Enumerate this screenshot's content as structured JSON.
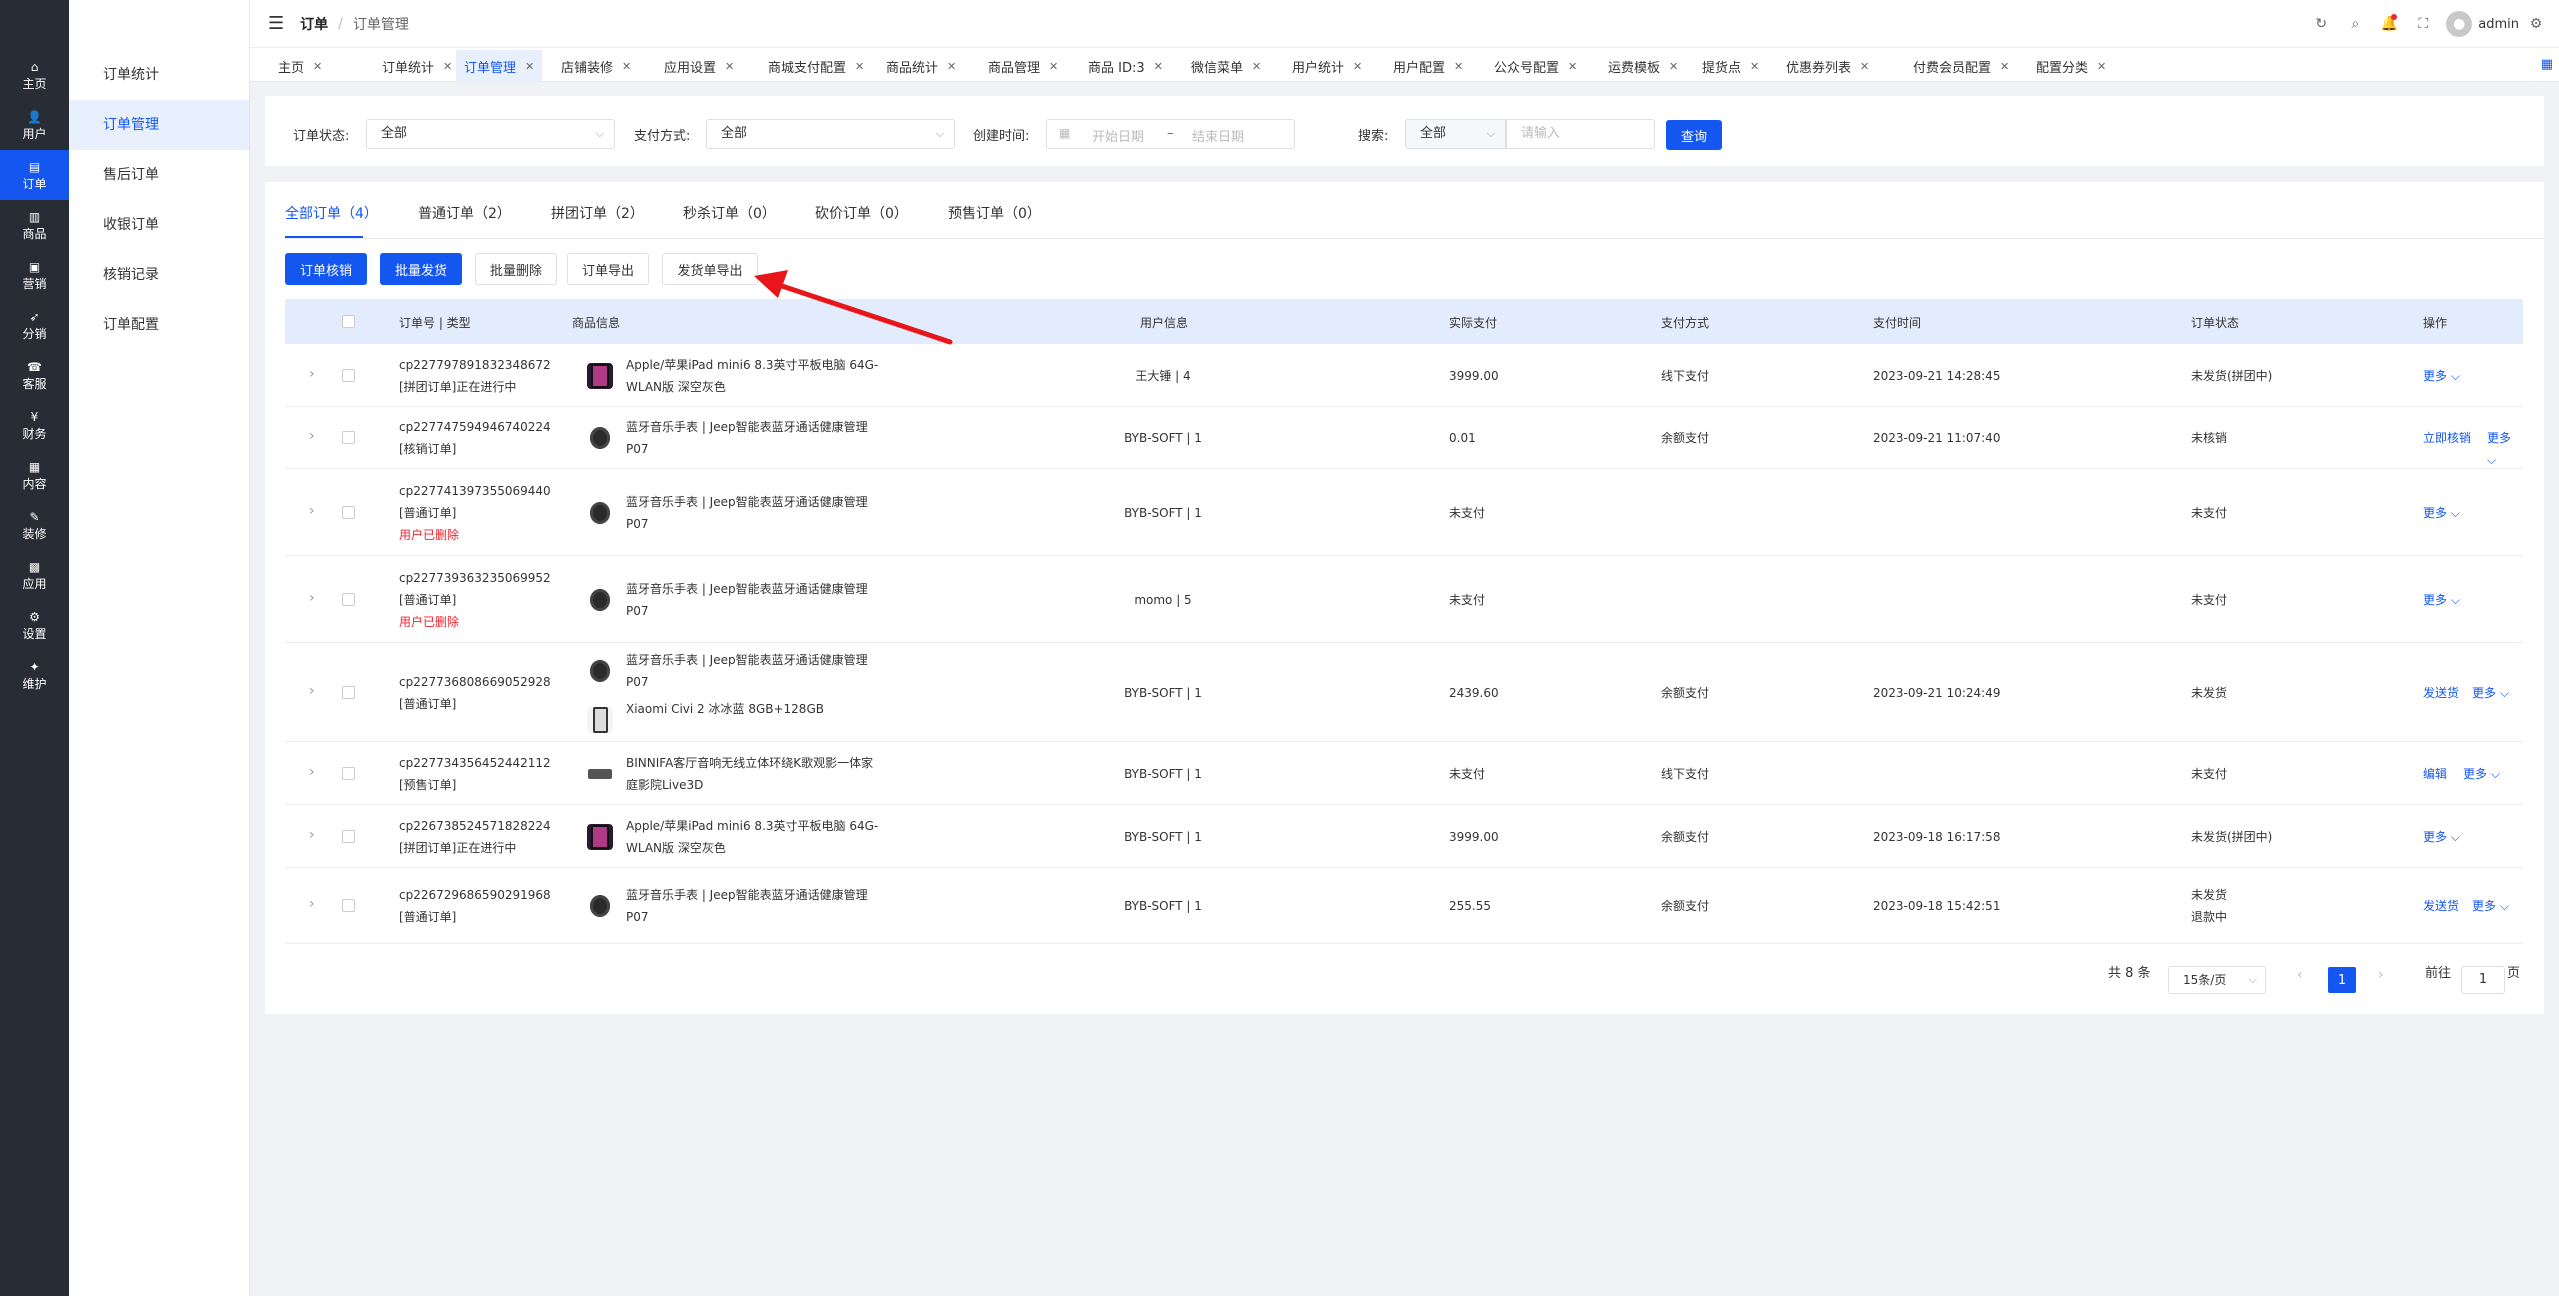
{
  "sidebar": {
    "items": [
      {
        "label": "主页",
        "icon": "⌂"
      },
      {
        "label": "用户",
        "icon": "👤"
      },
      {
        "label": "订单",
        "icon": "▤"
      },
      {
        "label": "商品",
        "icon": "▥"
      },
      {
        "label": "营销",
        "icon": "▣"
      },
      {
        "label": "分销",
        "icon": "➶"
      },
      {
        "label": "客服",
        "icon": "☎"
      },
      {
        "label": "财务",
        "icon": "¥"
      },
      {
        "label": "内容",
        "icon": "▦"
      },
      {
        "label": "装修",
        "icon": "✎"
      },
      {
        "label": "应用",
        "icon": "▩"
      },
      {
        "label": "设置",
        "icon": "⚙"
      },
      {
        "label": "维护",
        "icon": "✦"
      }
    ]
  },
  "subnav": {
    "items": [
      "订单统计",
      "订单管理",
      "售后订单",
      "收银订单",
      "核销记录",
      "订单配置"
    ]
  },
  "header": {
    "breadcrumb_root": "订单",
    "breadcrumb_sep": "/",
    "breadcrumb_current": "订单管理",
    "user": "admin"
  },
  "tabs": [
    "主页",
    "订单统计",
    "订单管理",
    "店铺装修",
    "应用设置",
    "商城支付配置",
    "商品统计",
    "商品管理",
    "商品 ID:3",
    "微信菜单",
    "用户统计",
    "用户配置",
    "公众号配置",
    "运费模板",
    "提货点",
    "优惠券列表",
    "付费会员配置",
    "配置分类"
  ],
  "filters": {
    "status_label": "订单状态:",
    "status_value": "全部",
    "pay_label": "支付方式:",
    "pay_value": "全部",
    "time_label": "创建时间:",
    "start_placeholder": "开始日期",
    "date_sep": "–",
    "end_placeholder": "结束日期",
    "search_label": "搜索:",
    "search_scope": "全部",
    "search_placeholder": "请输入",
    "query_button": "查询"
  },
  "order_tabs": [
    "全部订单（4）",
    "普通订单（2）",
    "拼团订单（2）",
    "秒杀订单（0）",
    "砍价订单（0）",
    "预售订单（0）"
  ],
  "actions": {
    "verify": "订单核销",
    "batch_ship": "批量发货",
    "batch_delete": "批量删除",
    "export_orders": "订单导出",
    "export_shipping": "发货单导出"
  },
  "table": {
    "headers": [
      "订单号 | 类型",
      "商品信息",
      "用户信息",
      "实际支付",
      "支付方式",
      "支付时间",
      "订单状态",
      "操作"
    ],
    "rows": [
      {
        "order_no": "cp227797891832348672",
        "type": "[拼团订单]正在进行中",
        "deleted": "",
        "products": [
          {
            "name1": "Apple/苹果iPad mini6 8.3英寸平板电脑 64G-",
            "name2": "WLAN版 深空灰色",
            "thumb": "ipad"
          }
        ],
        "user": "王大锤 | 4",
        "paid": "3999.00",
        "method": "线下支付",
        "time": "2023-09-21 14:28:45",
        "status": "未发货(拼团中)",
        "status2": "",
        "op1": "",
        "more": "更多 ⌵"
      },
      {
        "order_no": "cp227747594946740224",
        "type": "[核销订单]",
        "deleted": "",
        "products": [
          {
            "name1": "蓝牙音乐手表 | Jeep智能表蓝牙通话健康管理",
            "name2": "P07",
            "thumb": "watch"
          }
        ],
        "user": "BYB-SOFT | 1",
        "paid": "0.01",
        "method": "余额支付",
        "time": "2023-09-21 11:07:40",
        "status": "未核销",
        "status2": "",
        "op1": "立即核销",
        "more": "更多 ⌵"
      },
      {
        "order_no": "cp227741397355069440",
        "type": "[普通订单]",
        "deleted": "用户已删除",
        "products": [
          {
            "name1": "蓝牙音乐手表 | Jeep智能表蓝牙通话健康管理",
            "name2": "P07",
            "thumb": "watch"
          }
        ],
        "user": "BYB-SOFT | 1",
        "paid": "未支付",
        "method": "",
        "time": "",
        "status": "未支付",
        "status2": "",
        "op1": "",
        "more": "更多 ⌵"
      },
      {
        "order_no": "cp227739363235069952",
        "type": "[普通订单]",
        "deleted": "用户已删除",
        "products": [
          {
            "name1": "蓝牙音乐手表 | Jeep智能表蓝牙通话健康管理",
            "name2": "P07",
            "thumb": "watch"
          }
        ],
        "user": "momo | 5",
        "paid": "未支付",
        "method": "",
        "time": "",
        "status": "未支付",
        "status2": "",
        "op1": "",
        "more": "更多 ⌵"
      },
      {
        "order_no": "cp227736808669052928",
        "type": "[普通订单]",
        "deleted": "",
        "products": [
          {
            "name1": "蓝牙音乐手表 | Jeep智能表蓝牙通话健康管理",
            "name2": "P07",
            "thumb": "watch"
          },
          {
            "name1": "Xiaomi Civi 2 冰冰蓝 8GB+128GB",
            "name2": "",
            "thumb": "phone"
          }
        ],
        "user": "BYB-SOFT | 1",
        "paid": "2439.60",
        "method": "余额支付",
        "time": "2023-09-21 10:24:49",
        "status": "未发货",
        "status2": "",
        "op1": "发送货",
        "more": "更多 ⌵"
      },
      {
        "order_no": "cp227734356452442112",
        "type": "[预售订单]",
        "deleted": "",
        "products": [
          {
            "name1": "BINNIFA客厅音响无线立体环绕K歌观影一体家",
            "name2": "庭影院Live3D",
            "thumb": "speaker"
          }
        ],
        "user": "BYB-SOFT | 1",
        "paid": "未支付",
        "method": "线下支付",
        "time": "",
        "status": "未支付",
        "status2": "",
        "op1": "编辑",
        "more": "更多 ⌵"
      },
      {
        "order_no": "cp226738524571828224",
        "type": "[拼团订单]正在进行中",
        "deleted": "",
        "products": [
          {
            "name1": "Apple/苹果iPad mini6 8.3英寸平板电脑 64G-",
            "name2": "WLAN版 深空灰色",
            "thumb": "ipad"
          }
        ],
        "user": "BYB-SOFT | 1",
        "paid": "3999.00",
        "method": "余额支付",
        "time": "2023-09-18 16:17:58",
        "status": "未发货(拼团中)",
        "status2": "",
        "op1": "",
        "more": "更多 ⌵"
      },
      {
        "order_no": "cp226729686590291968",
        "type": "[普通订单]",
        "deleted": "",
        "products": [
          {
            "name1": "蓝牙音乐手表 | Jeep智能表蓝牙通话健康管理",
            "name2": "P07",
            "thumb": "watch"
          }
        ],
        "user": "BYB-SOFT | 1",
        "paid": "255.55",
        "method": "余额支付",
        "time": "2023-09-18 15:42:51",
        "status": "未发货",
        "status2": "退款中",
        "op1": "发送货",
        "more": "更多 ⌵"
      }
    ]
  },
  "pagination": {
    "total": "共 8 条",
    "page_size": "15条/页",
    "current": "1",
    "goto_label": "前往",
    "goto_value": "1",
    "goto_suffix": "页"
  },
  "colors": {
    "accent": "#1456f0",
    "annotation_arrow": "#e8161a",
    "danger": "#f5222d"
  }
}
